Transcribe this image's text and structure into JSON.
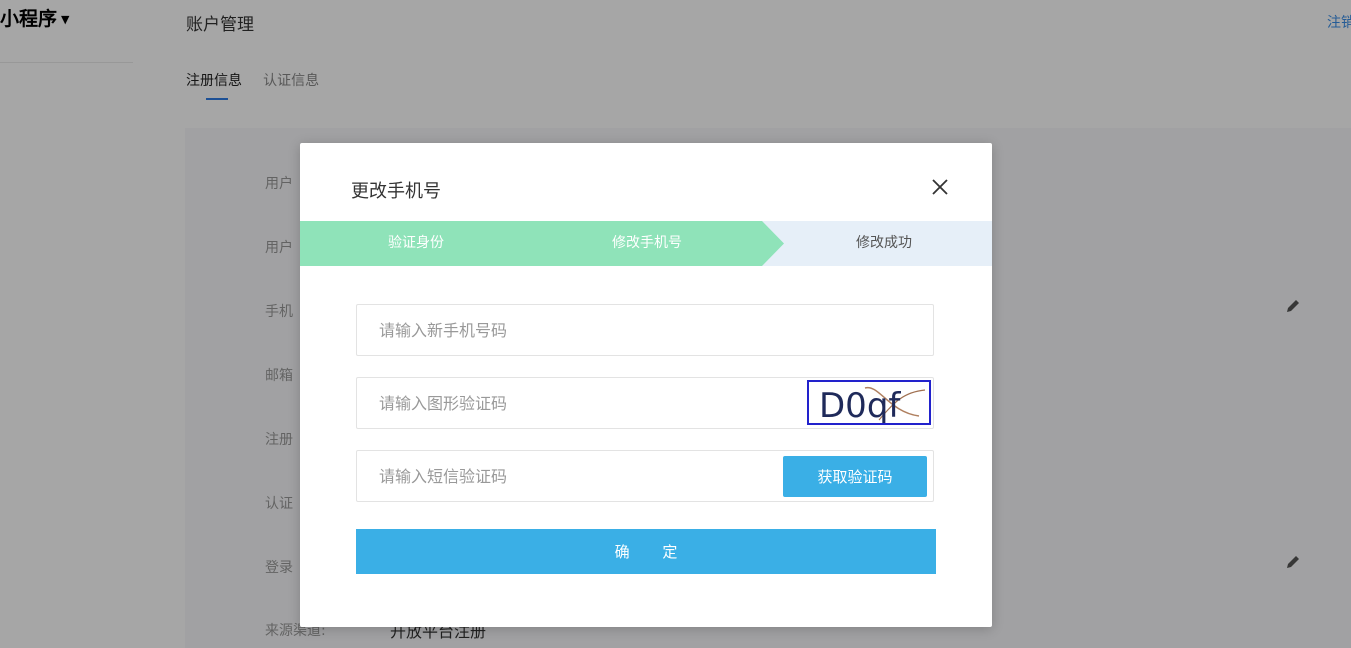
{
  "sidebar": {
    "brand": "小程序"
  },
  "header": {
    "title": "账户管理",
    "top_link": "注销"
  },
  "tabs": [
    {
      "label": "注册信息",
      "active": true
    },
    {
      "label": "认证信息",
      "active": false
    }
  ],
  "info_rows": [
    {
      "label": "用户"
    },
    {
      "label": "用户"
    },
    {
      "label": "手机"
    },
    {
      "label": "邮箱"
    },
    {
      "label": "注册"
    },
    {
      "label": "认证"
    },
    {
      "label": "登录"
    },
    {
      "label": "来源渠道:",
      "value": "开放平台注册"
    }
  ],
  "modal": {
    "title": "更改手机号",
    "steps": [
      "验证身份",
      "修改手机号",
      "修改成功"
    ],
    "phone_placeholder": "请输入新手机号码",
    "captcha_placeholder": "请输入图形验证码",
    "captcha_text": "D0qf",
    "sms_placeholder": "请输入短信验证码",
    "sms_button": "获取验证码",
    "confirm_button": "确 定"
  },
  "colors": {
    "step_active": "#8fe3b9",
    "step_pending": "#e6eff8",
    "primary": "#3aafe6"
  }
}
